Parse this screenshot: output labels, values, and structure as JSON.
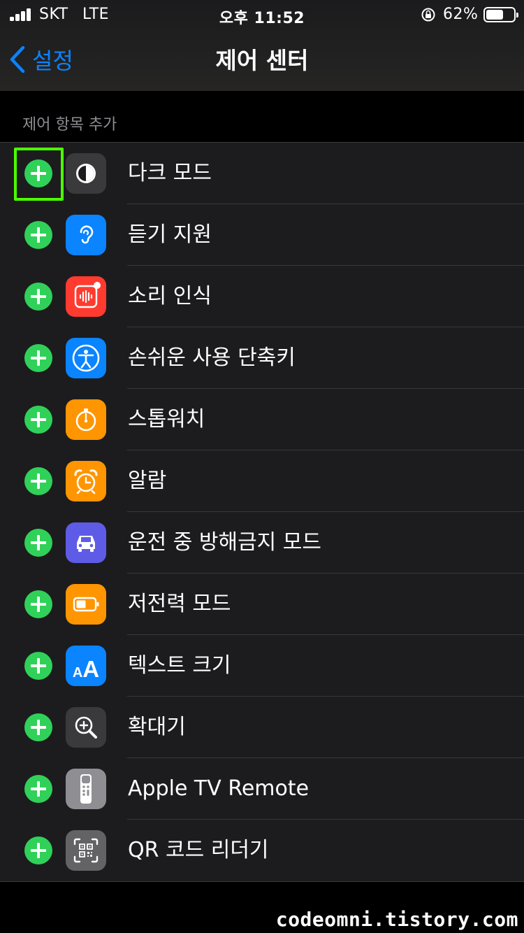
{
  "status_bar": {
    "carrier": "SKT",
    "network": "LTE",
    "time": "오후 11:52",
    "battery_percent": "62%",
    "battery_level": 0.62
  },
  "nav": {
    "back_label": "설정",
    "title": "제어 센터"
  },
  "section": {
    "header": "제어 항목 추가"
  },
  "items": [
    {
      "label": "다크 모드",
      "icon": "dark-mode-icon",
      "color": "#3a3a3c"
    },
    {
      "label": "듣기 지원",
      "icon": "hearing-icon",
      "color": "#0a84ff"
    },
    {
      "label": "소리 인식",
      "icon": "sound-recognition-icon",
      "color": "#ff3b30"
    },
    {
      "label": "손쉬운 사용 단축키",
      "icon": "accessibility-icon",
      "color": "#0a84ff"
    },
    {
      "label": "스톱워치",
      "icon": "stopwatch-icon",
      "color": "#ff9500"
    },
    {
      "label": "알람",
      "icon": "alarm-icon",
      "color": "#ff9500"
    },
    {
      "label": "운전 중 방해금지 모드",
      "icon": "car-icon",
      "color": "#5e5ce6"
    },
    {
      "label": "저전력 모드",
      "icon": "low-power-icon",
      "color": "#ff9500"
    },
    {
      "label": "텍스트 크기",
      "icon": "text-size-icon",
      "color": "#0a84ff"
    },
    {
      "label": "확대기",
      "icon": "magnifier-icon",
      "color": "#3a3a3c"
    },
    {
      "label": "Apple TV Remote",
      "icon": "tv-remote-icon",
      "color": "#8e8e93"
    },
    {
      "label": "QR 코드 리더기",
      "icon": "qr-code-icon",
      "color": "#636366"
    }
  ],
  "text_size_icon_text": {
    "small": "A",
    "large": "A"
  },
  "watermark": "codeomni.tistory.com"
}
